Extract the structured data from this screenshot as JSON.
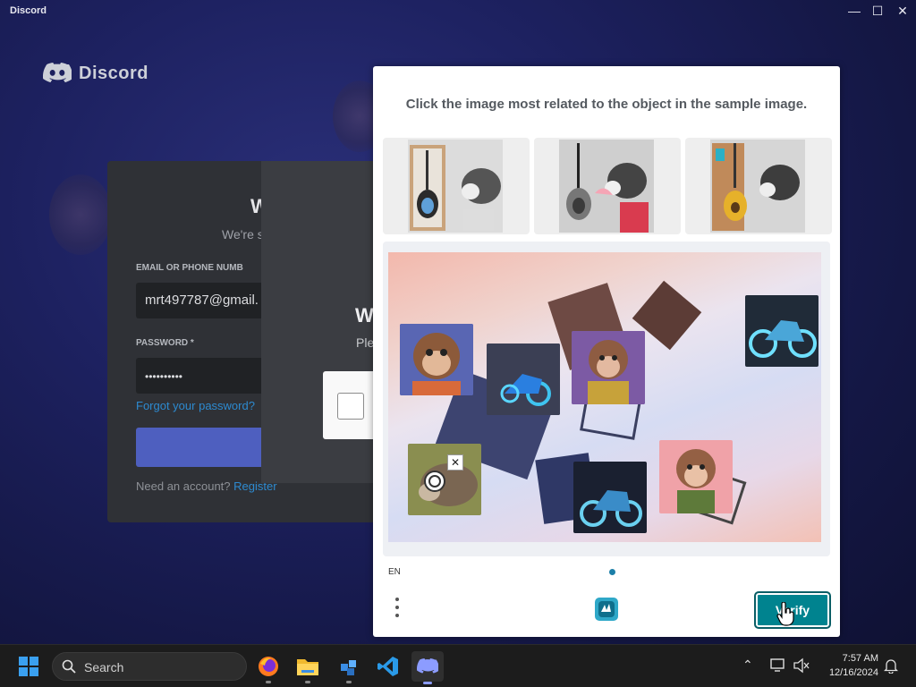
{
  "window": {
    "title": "Discord"
  },
  "login": {
    "heading": "W",
    "subheading": "We're s",
    "email_label": "EMAIL OR PHONE NUMB",
    "email_value": "mrt497787@gmail.",
    "password_label": "PASSWORD *",
    "password_value": "••••••••••",
    "forgot_link": "Forgot your password?",
    "need_account": "Need an account?",
    "register_link": "Register"
  },
  "dialog": {
    "title": "W",
    "subtitle": "Ple"
  },
  "captcha": {
    "prompt": "Click the image most related to the object in the sample image.",
    "language": "EN",
    "verify_label": "Verify",
    "accent": "#00838f"
  },
  "taskbar": {
    "search_label": "Search",
    "time": "7:57 AM",
    "date": "12/16/2024"
  }
}
